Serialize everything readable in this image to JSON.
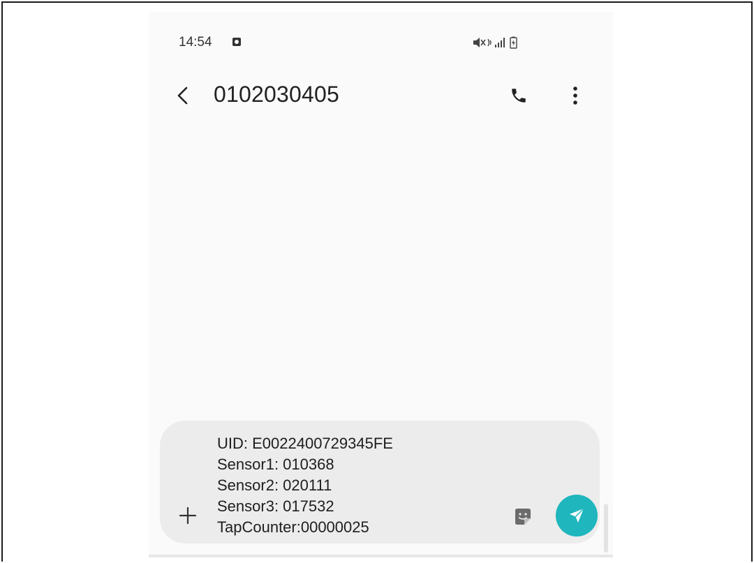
{
  "status_bar": {
    "time": "14:54",
    "icons": [
      "photo-icon",
      "mute-icon",
      "wifi-icon",
      "signal-icon",
      "battery-charging-icon"
    ]
  },
  "app_bar": {
    "title": "0102030405",
    "icons": [
      "back-arrow-icon",
      "phone-icon",
      "more-vert-icon"
    ]
  },
  "composer": {
    "message": "UID: E0022400729345FE\nSensor1: 010368\nSensor2: 020111\nSensor3: 017532\nTapCounter:00000025",
    "icons": [
      "plus-icon",
      "sticker-icon",
      "send-icon"
    ]
  },
  "colors": {
    "accent": "#1fb6bd",
    "background": "#fafafa",
    "composer_bg": "#ececec",
    "text": "#222222"
  }
}
